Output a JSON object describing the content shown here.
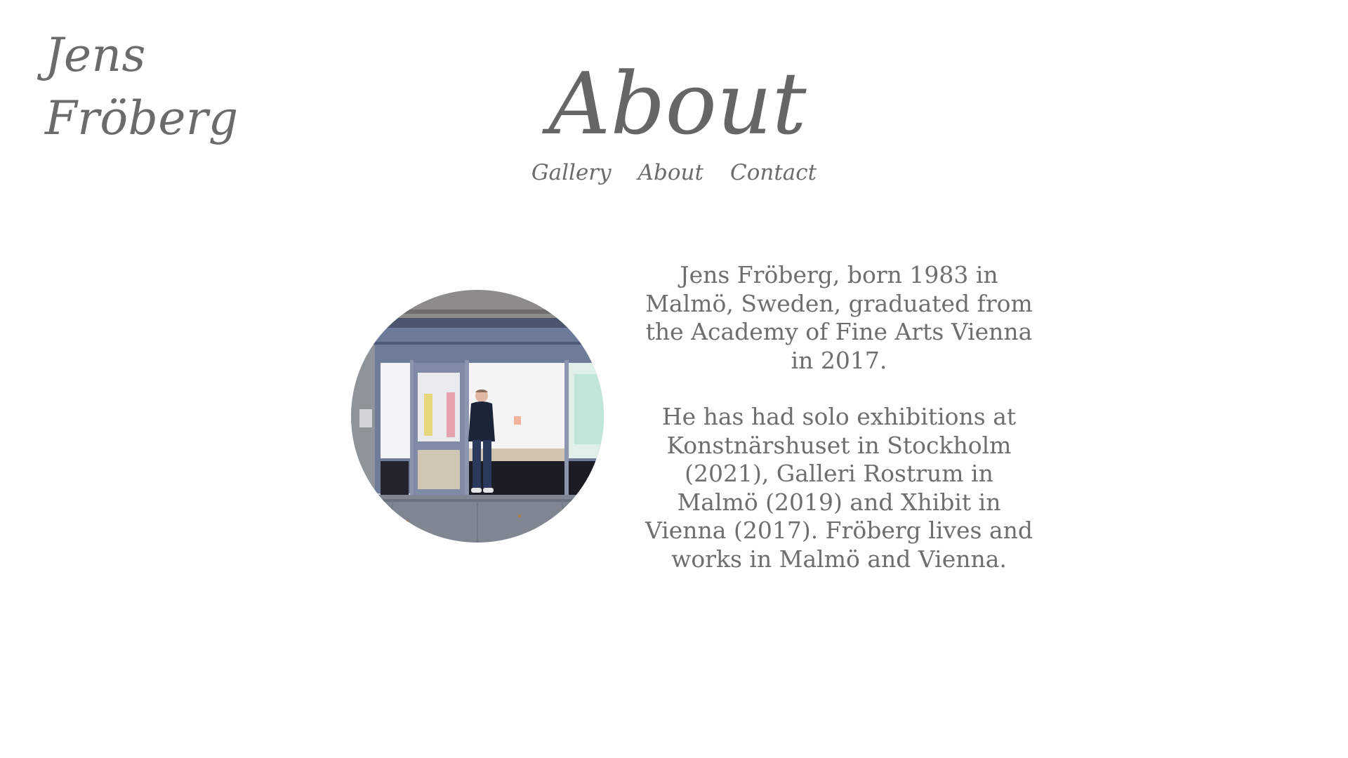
{
  "site": {
    "logo_line1": "Jens",
    "logo_line2": "Fröberg"
  },
  "page": {
    "title": "About"
  },
  "nav": {
    "items": [
      {
        "label": "Gallery"
      },
      {
        "label": "About"
      },
      {
        "label": "Contact"
      }
    ]
  },
  "about": {
    "paragraphs": [
      "Jens Fröberg, born 1983 in Malmö, Sweden, graduated from the Academy of Fine Arts Vienna in 2017.",
      "He has had solo exhibitions at Konstnärshuset in Stockholm (2021), Galleri Rostrum in Malmö (2019) and Xhibit in Vienna (2017). Fröberg lives and works in Malmö and Vienna."
    ]
  },
  "colors": {
    "text": "#6e6e6e",
    "background": "#ffffff"
  }
}
